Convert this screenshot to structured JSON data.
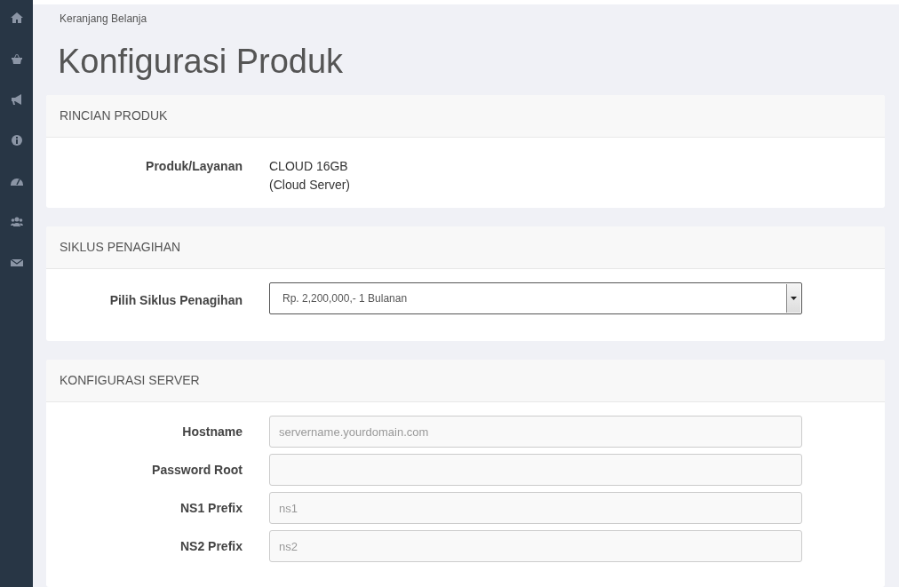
{
  "breadcrumb": "Keranjang Belanja",
  "title": "Konfigurasi Produk",
  "panels": [
    {
      "heading": "RINCIAN PRODUK",
      "rows": [
        {
          "kind": "text",
          "label": "Produk/Layanan",
          "lines": [
            "CLOUD 16GB",
            "(Cloud Server)"
          ]
        }
      ]
    },
    {
      "heading": "SIKLUS PENAGIHAN",
      "rows": [
        {
          "kind": "select",
          "label": "Pilih Siklus Penagihan",
          "value": "Rp. 2,200,000,- 1 Bulanan"
        }
      ]
    },
    {
      "heading": "KONFIGURASI SERVER",
      "rows": [
        {
          "kind": "input",
          "label": "Hostname",
          "placeholder": "servername.yourdomain.com"
        },
        {
          "kind": "input",
          "label": "Password Root"
        },
        {
          "kind": "input",
          "label": "NS1 Prefix",
          "placeholder": "ns1"
        },
        {
          "kind": "input",
          "label": "NS2 Prefix",
          "placeholder": "ns2"
        }
      ]
    }
  ]
}
